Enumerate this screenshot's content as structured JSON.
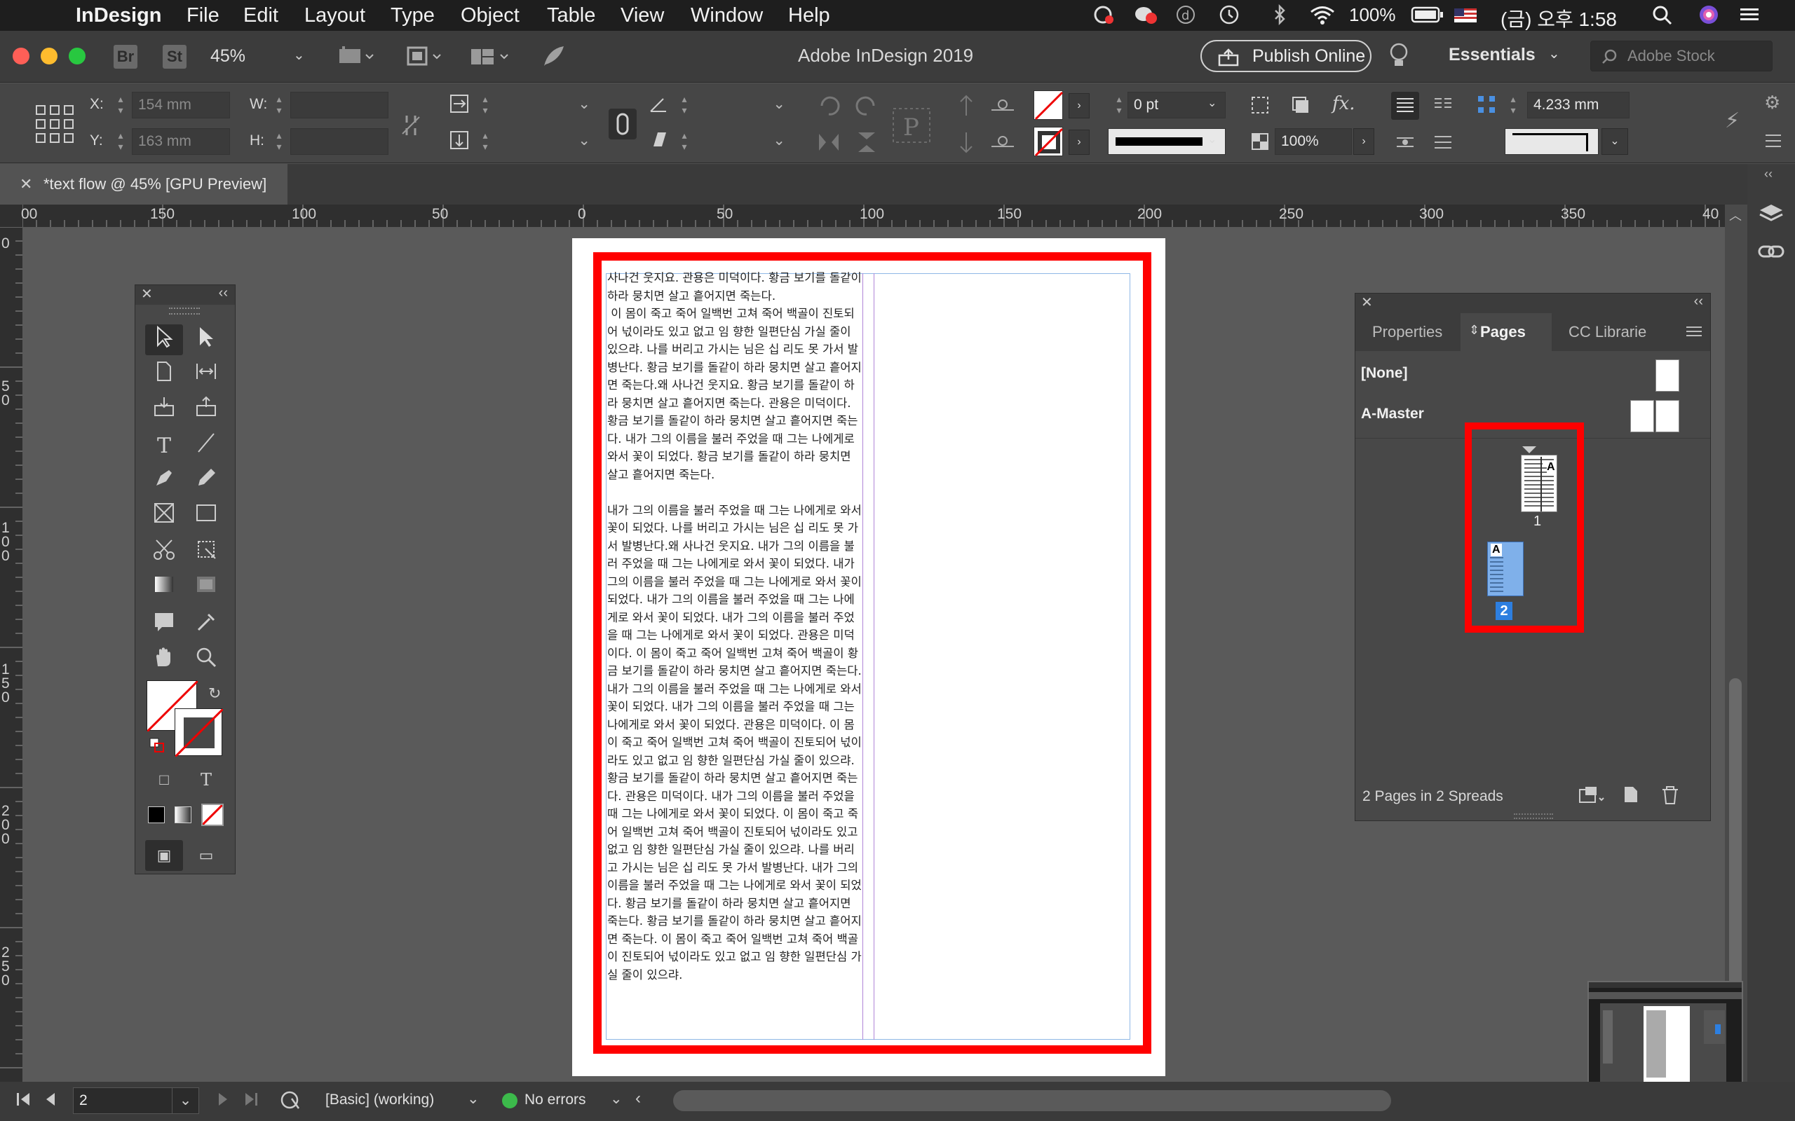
{
  "menubar": {
    "app_name": "InDesign",
    "items": [
      "File",
      "Edit",
      "Layout",
      "Type",
      "Object",
      "Table",
      "View",
      "Window",
      "Help"
    ],
    "battery": "100%",
    "datetime": "(금) 오후 1:58"
  },
  "appbar": {
    "bridge_label": "Br",
    "stock_label": "St",
    "zoom": "45%",
    "title": "Adobe InDesign 2019",
    "publish_label": "Publish Online",
    "workspace": "Essentials",
    "stock_search_placeholder": "Adobe Stock"
  },
  "control": {
    "x_label": "X:",
    "y_label": "Y:",
    "x_value": "154 mm",
    "y_value": "163 mm",
    "w_label": "W:",
    "h_label": "H:",
    "stroke_weight": "0 pt",
    "opacity": "100%",
    "spacing": "4.233 mm"
  },
  "document": {
    "tab_title": "*text flow @ 45% [GPU Preview]",
    "text": "사나건 웃지요. 관용은 미덕이다. 황금 보기를 돌같이 하라 뭉치면 살고 흩어지면 죽는다.\n 이 몸이 죽고 죽어 일백번 고쳐 죽어 백골이 진토되어 넋이라도 있고 없고 임 향한 일편단심 가실 줄이 있으랴. 나를 버리고 가시는 님은 십 리도 못 가서 발병난다. 황금 보기를 돌같이 하라 뭉치면 살고 흩어지면 죽는다.왜 사나건 웃지요. 황금 보기를 돌같이 하라 뭉치면 살고 흩어지면 죽는다. 관용은 미덕이다. 황금 보기를 돌같이 하라 뭉치면 살고 흩어지면 죽는다. 내가 그의 이름을 불러 주었을 때 그는 나에게로 와서 꽃이 되었다. 황금 보기를 돌같이 하라 뭉치면 살고 흩어지면 죽는다.\n\n내가 그의 이름을 불러 주었을 때 그는 나에게로 와서 꽃이 되었다. 나를 버리고 가시는 님은 십 리도 못 가서 발병난다.왜 사나건 웃지요. 내가 그의 이름을 불러 주었을 때 그는 나에게로 와서 꽃이 되었다. 내가 그의 이름을 불러 주었을 때 그는 나에게로 와서 꽃이 되었다. 내가 그의 이름을 불러 주었을 때 그는 나에게로 와서 꽃이 되었다. 내가 그의 이름을 불러 주었을 때 그는 나에게로 와서 꽃이 되었다. 관용은 미덕이다. 이 몸이 죽고 죽어 일백번 고쳐 죽어 백골이 황금 보기를 돌같이 하라 뭉치면 살고 흩어지면 죽는다. 내가 그의 이름을 불러 주었을 때 그는 나에게로 와서 꽃이 되었다. 내가 그의 이름을 불러 주었을 때 그는 나에게로 와서 꽃이 되었다. 관용은 미덕이다. 이 몸이 죽고 죽어 일백번 고쳐 죽어 백골이 진토되어 넋이라도 있고 없고 임 향한 일편단심 가실 줄이 있으랴. 황금 보기를 돌같이 하라 뭉치면 살고 흩어지면 죽는다. 관용은 미덕이다. 내가 그의 이름을 불러 주었을 때 그는 나에게로 와서 꽃이 되었다. 이 몸이 죽고 죽어 일백번 고쳐 죽어 백골이 진토되어 넋이라도 있고 없고 임 향한 일편단심 가실 줄이 있으랴. 나를 버리고 가시는 님은 십 리도 못 가서 발병난다. 내가 그의 이름을 불러 주었을 때 그는 나에게로 와서 꽃이 되었다. 황금 보기를 돌같이 하라 뭉치면 살고 흩어지면 죽는다. 황금 보기를 돌같이 하라 뭉치면 살고 흩어지면 죽는다. 이 몸이 죽고 죽어 일백번 고쳐 죽어 백골이 진토되어 넋이라도 있고 없고 임 향한 일편단심 가실 줄이 있으랴."
  },
  "rulers": {
    "h_ticks": [
      "00",
      "150",
      "100",
      "50",
      "0",
      "50",
      "100",
      "150",
      "200",
      "250",
      "300",
      "350",
      "40"
    ],
    "v_ticks": [
      "0",
      "50",
      "100",
      "150",
      "200",
      "250"
    ]
  },
  "pages_panel": {
    "tabs": [
      "Properties",
      "Pages",
      "CC Librarie"
    ],
    "none_label": "[None]",
    "master_label": "A-Master",
    "page1_num": "1",
    "page2_num": "2",
    "page_prefix": "A",
    "footer_text": "2 Pages in 2 Spreads"
  },
  "statusbar": {
    "page_value": "2",
    "style": "[Basic] (working)",
    "preflight": "No errors"
  },
  "colors": {
    "highlight_red": "#ff0000",
    "selection_blue": "#2d7fe0",
    "preflight_green": "#3cba4b"
  }
}
